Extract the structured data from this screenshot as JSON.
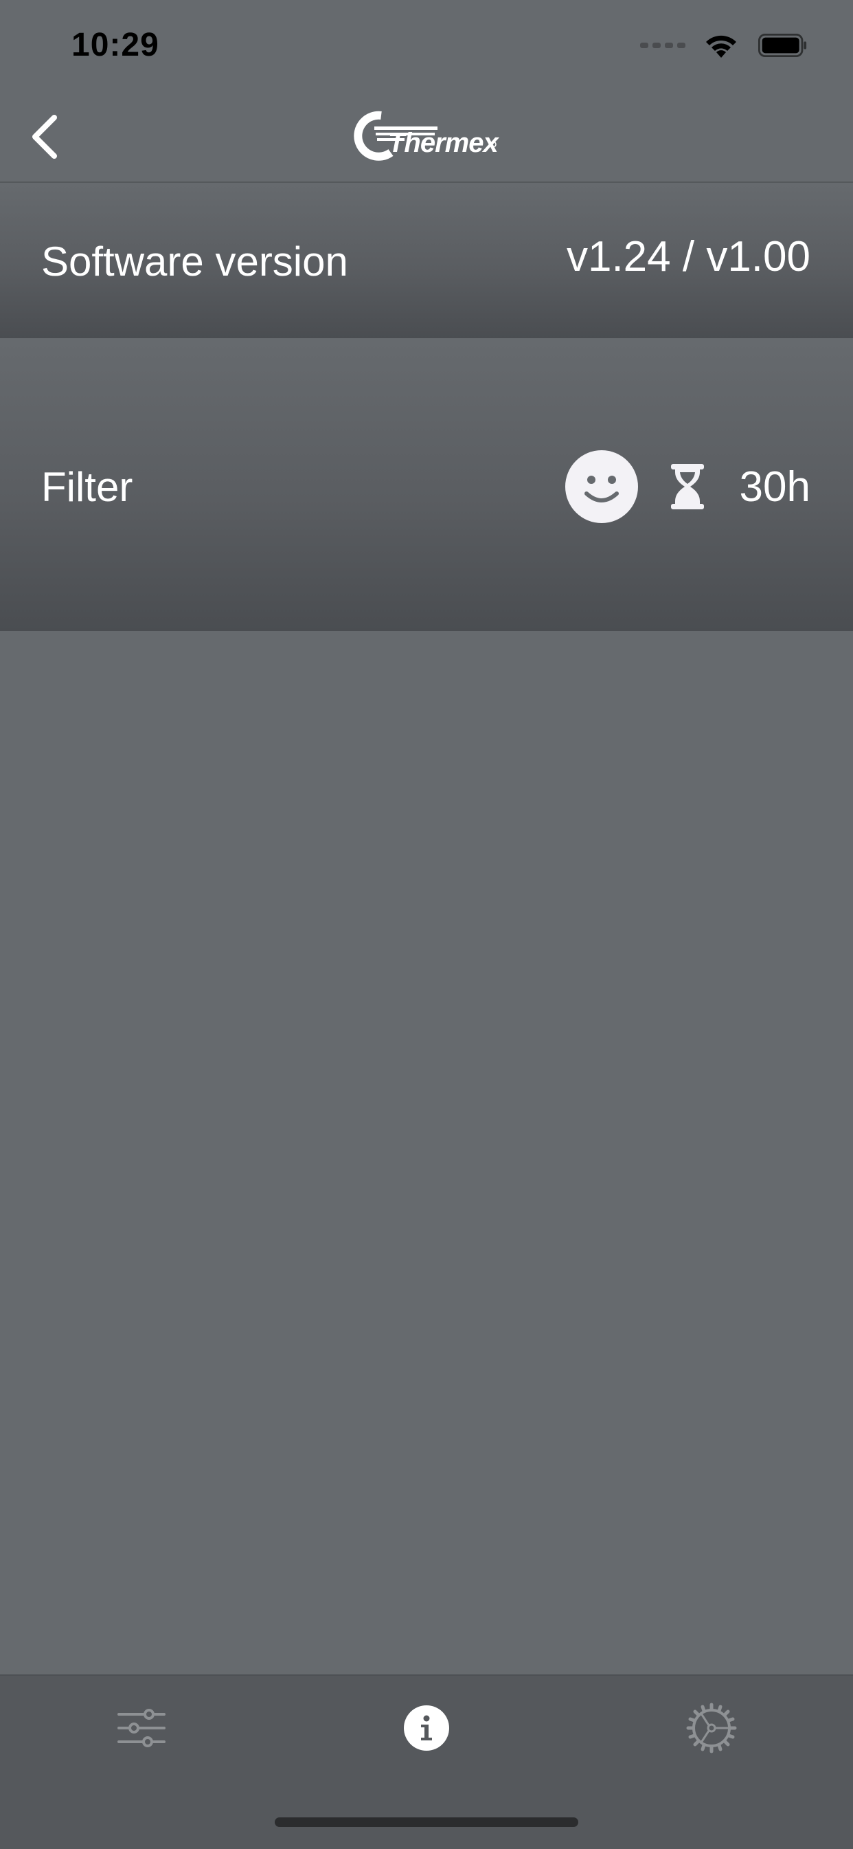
{
  "status_bar": {
    "time": "10:29",
    "icons": [
      "signal-icon",
      "wifi-icon",
      "battery-icon"
    ]
  },
  "header": {
    "back_icon": "chevron-left-icon",
    "brand": "Thermex"
  },
  "software": {
    "label": "Software version",
    "value": "v1.24 / v1.00"
  },
  "filter": {
    "label": "Filter",
    "status_icon": "smiley-icon",
    "timer_icon": "hourglass-icon",
    "hours": "30h"
  },
  "tab_bar": {
    "tabs": [
      {
        "icon": "sliders-icon",
        "active": false
      },
      {
        "icon": "info-icon",
        "active": true
      },
      {
        "icon": "gear-icon",
        "active": false
      }
    ]
  },
  "colors": {
    "background": "#666a6e",
    "tab_bar": "#55585c",
    "text": "#ffffff",
    "inactive_icon": "#8e9194"
  }
}
